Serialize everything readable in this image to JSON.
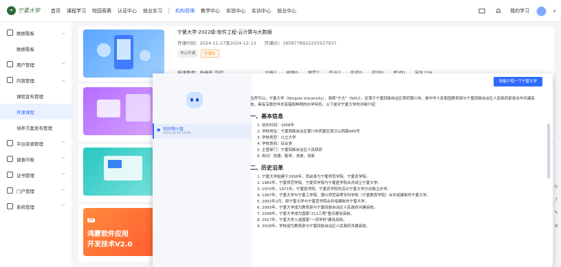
{
  "nav": {
    "logo": "宁夏大学",
    "items": [
      "首页",
      "课程学习",
      "校园竞赛",
      "认证中心",
      "就业实习"
    ],
    "items2": [
      "机构管理",
      "教学中心",
      "实验中心",
      "实训中心",
      "就业中心"
    ],
    "user": "我的学习"
  },
  "sidebar": {
    "groups": [
      {
        "label": "数据看板",
        "sub": [
          "数据看板"
        ]
      },
      {
        "label": "用户管理",
        "sub": []
      },
      {
        "label": "内容管理",
        "sub": [
          "课程宣布管理",
          "开课课程",
          "培养方案发布管理"
        ]
      },
      {
        "label": "平台资源管理",
        "sub": []
      },
      {
        "label": "调查问卷",
        "sub": []
      },
      {
        "label": "证书管理",
        "sub": []
      },
      {
        "label": "门户管理",
        "sub": []
      },
      {
        "label": "系统管理",
        "sub": []
      }
    ]
  },
  "course": {
    "title": "宁夏大学-2022级-软件工程-云计算与大数据",
    "time": "开课时间：2024-11-27至2024-12-13",
    "id": "开课ID：1858778922255527937",
    "tag1": "非公开课",
    "tag2": "开课中",
    "teacher": "授课教师：张春旺,刘欣",
    "stats": [
      "文档7",
      "视频0",
      "课堂7",
      "作业2",
      "实验0",
      "实训0",
      "考试0",
      "学生159"
    ]
  },
  "card4": {
    "badge": "JH",
    "line1": "鸿蒙软件应用",
    "line2": "开发技术V2.0"
  },
  "overlay": {
    "button": "你能介绍一下宁夏大学",
    "history_title": "你好啊小智",
    "history_date": "2025-02-20 14:46",
    "intro": "当然可以。宁夏大学（Ningxia University），简称\"宁大\"（NXU），坐落于宁夏回族自治区首府银川市，是中华人民和国教育部与宁夏回族自治区人民政府部省合作共建高校，具有深厚的学术底蕴和鲜明的办学特色。以下是对宁夏大学的详细介绍：",
    "section1": "一、基本信息",
    "basic": [
      "1. 创办时间：1958年",
      "2. 学校地址：宁夏回族自治区银川市西夏区贺兰山西路489号",
      "3. 学校类型：公立大学",
      "4. 学校类别：综合类",
      "5. 主管部门：宁夏回族自治区人民政府",
      "6. 校训：尚德、勤学、求是、创新"
    ],
    "section2": "二、历史沿革",
    "history": [
      "1. 宁夏大学始建于1958年，其前身为宁夏师范学院、宁夏农学院。",
      "2. 1962年，宁夏师范学院、宁夏农学院与宁夏医学院合并成立宁夏大学。",
      "3. 1970年、1971年，宁夏医学院、宁夏农学院先后从宁夏大学分出独立办学。",
      "4. 1997年，宁夏大学与宁夏工学院、银川师范高等专科学校（宁夏教育学院）合并组建新的宁夏大学。",
      "5. 2002年2月，原宁夏大学与宁夏农学院合并组建新的宁夏大学。",
      "6. 2005年，宁夏大学成为教育部与宁夏回族自治区人民政府共建高校。",
      "7. 2008年，宁夏大学成为国家\"211工程\"重点建设高校。",
      "8. 2017年，宁夏大学入选国家\"一流学科\"建设高校。",
      "9. 2018年，学校成为教育部与宁夏回族自治区人民政府共建高校。"
    ]
  }
}
